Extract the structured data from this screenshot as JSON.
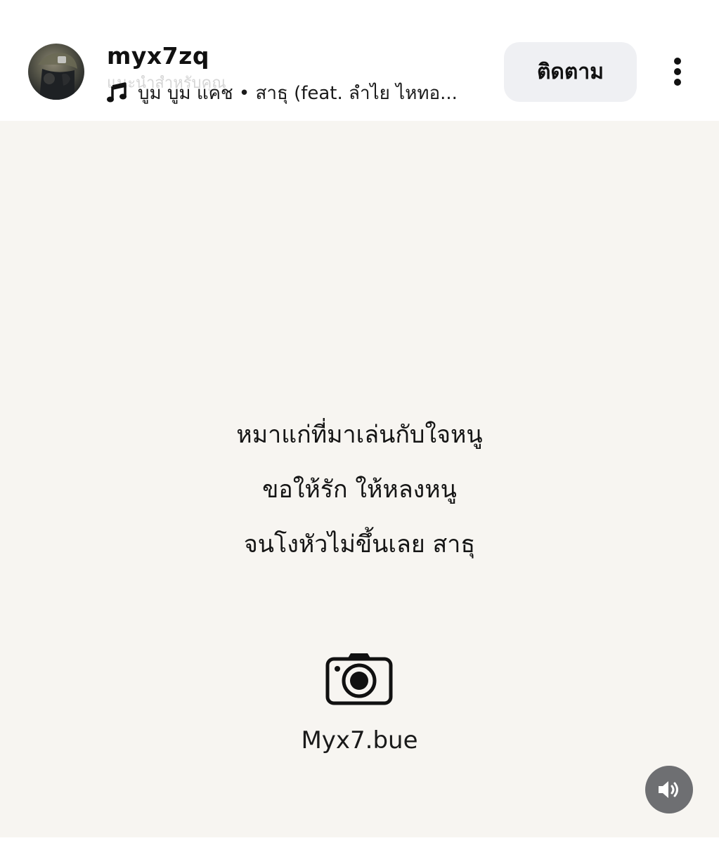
{
  "header": {
    "username": "myx7zq",
    "ghost_subtitle": "แนะนำสำหรับคุณ",
    "music_text": "บูม บูม แคช • สาธุ (feat. ลำไย ไหทอ...",
    "follow_label": "ติดตาม",
    "avatar_icon": "avatar",
    "music_icon": "music-note-icon",
    "more_icon": "more-vertical-icon"
  },
  "post": {
    "lyrics": [
      "หมาแก่ที่มาเล่นกับใจหนู",
      "ขอให้รัก ให้หลงหนู",
      "จนโงหัวไม่ขึ้นเลย สาธุ"
    ],
    "camera_icon": "camera-icon",
    "handle": "Myx7.bue",
    "sound_icon": "speaker-icon",
    "background_color": "#f7f5f1"
  },
  "colors": {
    "follow_button_bg": "#eff0f3",
    "sound_button_bg": "#6e6f72"
  }
}
